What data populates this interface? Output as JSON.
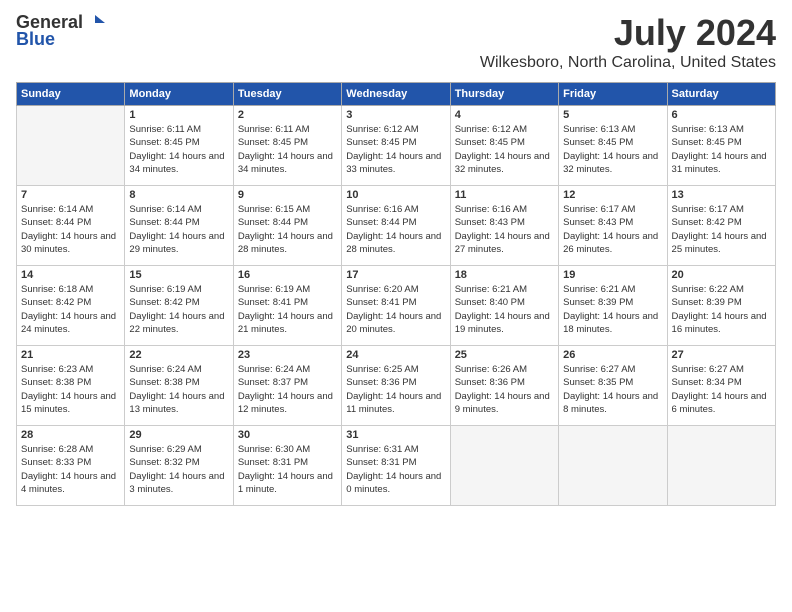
{
  "logo": {
    "general": "General",
    "blue": "Blue"
  },
  "header": {
    "title": "July 2024",
    "subtitle": "Wilkesboro, North Carolina, United States"
  },
  "weekdays": [
    "Sunday",
    "Monday",
    "Tuesday",
    "Wednesday",
    "Thursday",
    "Friday",
    "Saturday"
  ],
  "weeks": [
    [
      {
        "day": "",
        "sunrise": "",
        "sunset": "",
        "daylight": ""
      },
      {
        "day": "1",
        "sunrise": "Sunrise: 6:11 AM",
        "sunset": "Sunset: 8:45 PM",
        "daylight": "Daylight: 14 hours and 34 minutes."
      },
      {
        "day": "2",
        "sunrise": "Sunrise: 6:11 AM",
        "sunset": "Sunset: 8:45 PM",
        "daylight": "Daylight: 14 hours and 34 minutes."
      },
      {
        "day": "3",
        "sunrise": "Sunrise: 6:12 AM",
        "sunset": "Sunset: 8:45 PM",
        "daylight": "Daylight: 14 hours and 33 minutes."
      },
      {
        "day": "4",
        "sunrise": "Sunrise: 6:12 AM",
        "sunset": "Sunset: 8:45 PM",
        "daylight": "Daylight: 14 hours and 32 minutes."
      },
      {
        "day": "5",
        "sunrise": "Sunrise: 6:13 AM",
        "sunset": "Sunset: 8:45 PM",
        "daylight": "Daylight: 14 hours and 32 minutes."
      },
      {
        "day": "6",
        "sunrise": "Sunrise: 6:13 AM",
        "sunset": "Sunset: 8:45 PM",
        "daylight": "Daylight: 14 hours and 31 minutes."
      }
    ],
    [
      {
        "day": "7",
        "sunrise": "Sunrise: 6:14 AM",
        "sunset": "Sunset: 8:44 PM",
        "daylight": "Daylight: 14 hours and 30 minutes."
      },
      {
        "day": "8",
        "sunrise": "Sunrise: 6:14 AM",
        "sunset": "Sunset: 8:44 PM",
        "daylight": "Daylight: 14 hours and 29 minutes."
      },
      {
        "day": "9",
        "sunrise": "Sunrise: 6:15 AM",
        "sunset": "Sunset: 8:44 PM",
        "daylight": "Daylight: 14 hours and 28 minutes."
      },
      {
        "day": "10",
        "sunrise": "Sunrise: 6:16 AM",
        "sunset": "Sunset: 8:44 PM",
        "daylight": "Daylight: 14 hours and 28 minutes."
      },
      {
        "day": "11",
        "sunrise": "Sunrise: 6:16 AM",
        "sunset": "Sunset: 8:43 PM",
        "daylight": "Daylight: 14 hours and 27 minutes."
      },
      {
        "day": "12",
        "sunrise": "Sunrise: 6:17 AM",
        "sunset": "Sunset: 8:43 PM",
        "daylight": "Daylight: 14 hours and 26 minutes."
      },
      {
        "day": "13",
        "sunrise": "Sunrise: 6:17 AM",
        "sunset": "Sunset: 8:42 PM",
        "daylight": "Daylight: 14 hours and 25 minutes."
      }
    ],
    [
      {
        "day": "14",
        "sunrise": "Sunrise: 6:18 AM",
        "sunset": "Sunset: 8:42 PM",
        "daylight": "Daylight: 14 hours and 24 minutes."
      },
      {
        "day": "15",
        "sunrise": "Sunrise: 6:19 AM",
        "sunset": "Sunset: 8:42 PM",
        "daylight": "Daylight: 14 hours and 22 minutes."
      },
      {
        "day": "16",
        "sunrise": "Sunrise: 6:19 AM",
        "sunset": "Sunset: 8:41 PM",
        "daylight": "Daylight: 14 hours and 21 minutes."
      },
      {
        "day": "17",
        "sunrise": "Sunrise: 6:20 AM",
        "sunset": "Sunset: 8:41 PM",
        "daylight": "Daylight: 14 hours and 20 minutes."
      },
      {
        "day": "18",
        "sunrise": "Sunrise: 6:21 AM",
        "sunset": "Sunset: 8:40 PM",
        "daylight": "Daylight: 14 hours and 19 minutes."
      },
      {
        "day": "19",
        "sunrise": "Sunrise: 6:21 AM",
        "sunset": "Sunset: 8:39 PM",
        "daylight": "Daylight: 14 hours and 18 minutes."
      },
      {
        "day": "20",
        "sunrise": "Sunrise: 6:22 AM",
        "sunset": "Sunset: 8:39 PM",
        "daylight": "Daylight: 14 hours and 16 minutes."
      }
    ],
    [
      {
        "day": "21",
        "sunrise": "Sunrise: 6:23 AM",
        "sunset": "Sunset: 8:38 PM",
        "daylight": "Daylight: 14 hours and 15 minutes."
      },
      {
        "day": "22",
        "sunrise": "Sunrise: 6:24 AM",
        "sunset": "Sunset: 8:38 PM",
        "daylight": "Daylight: 14 hours and 13 minutes."
      },
      {
        "day": "23",
        "sunrise": "Sunrise: 6:24 AM",
        "sunset": "Sunset: 8:37 PM",
        "daylight": "Daylight: 14 hours and 12 minutes."
      },
      {
        "day": "24",
        "sunrise": "Sunrise: 6:25 AM",
        "sunset": "Sunset: 8:36 PM",
        "daylight": "Daylight: 14 hours and 11 minutes."
      },
      {
        "day": "25",
        "sunrise": "Sunrise: 6:26 AM",
        "sunset": "Sunset: 8:36 PM",
        "daylight": "Daylight: 14 hours and 9 minutes."
      },
      {
        "day": "26",
        "sunrise": "Sunrise: 6:27 AM",
        "sunset": "Sunset: 8:35 PM",
        "daylight": "Daylight: 14 hours and 8 minutes."
      },
      {
        "day": "27",
        "sunrise": "Sunrise: 6:27 AM",
        "sunset": "Sunset: 8:34 PM",
        "daylight": "Daylight: 14 hours and 6 minutes."
      }
    ],
    [
      {
        "day": "28",
        "sunrise": "Sunrise: 6:28 AM",
        "sunset": "Sunset: 8:33 PM",
        "daylight": "Daylight: 14 hours and 4 minutes."
      },
      {
        "day": "29",
        "sunrise": "Sunrise: 6:29 AM",
        "sunset": "Sunset: 8:32 PM",
        "daylight": "Daylight: 14 hours and 3 minutes."
      },
      {
        "day": "30",
        "sunrise": "Sunrise: 6:30 AM",
        "sunset": "Sunset: 8:31 PM",
        "daylight": "Daylight: 14 hours and 1 minute."
      },
      {
        "day": "31",
        "sunrise": "Sunrise: 6:31 AM",
        "sunset": "Sunset: 8:31 PM",
        "daylight": "Daylight: 14 hours and 0 minutes."
      },
      {
        "day": "",
        "sunrise": "",
        "sunset": "",
        "daylight": ""
      },
      {
        "day": "",
        "sunrise": "",
        "sunset": "",
        "daylight": ""
      },
      {
        "day": "",
        "sunrise": "",
        "sunset": "",
        "daylight": ""
      }
    ]
  ]
}
